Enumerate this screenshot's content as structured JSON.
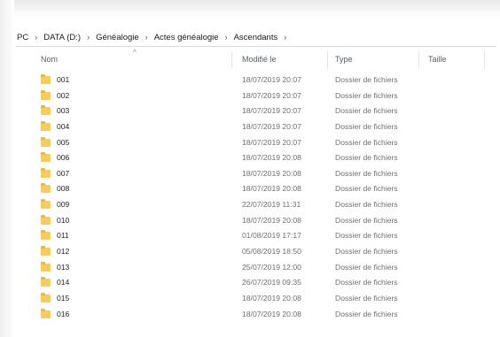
{
  "breadcrumb": [
    "PC",
    "DATA (D:)",
    "Généalogie",
    "Actes généalogie",
    "Ascendants"
  ],
  "breadcrumb_separator": "›",
  "columns": {
    "name": "Nom",
    "modified": "Modifié le",
    "type": "Type",
    "size": "Taille"
  },
  "sort_indicator": "^",
  "rows": [
    {
      "name": "001",
      "modified": "18/07/2019 20:07",
      "type": "Dossier de fichiers"
    },
    {
      "name": "002",
      "modified": "18/07/2019 20:07",
      "type": "Dossier de fichiers"
    },
    {
      "name": "003",
      "modified": "18/07/2019 20:07",
      "type": "Dossier de fichiers"
    },
    {
      "name": "004",
      "modified": "18/07/2019 20:07",
      "type": "Dossier de fichiers"
    },
    {
      "name": "005",
      "modified": "18/07/2019 20:07",
      "type": "Dossier de fichiers"
    },
    {
      "name": "006",
      "modified": "18/07/2019 20:08",
      "type": "Dossier de fichiers"
    },
    {
      "name": "007",
      "modified": "18/07/2019 20:08",
      "type": "Dossier de fichiers"
    },
    {
      "name": "008",
      "modified": "18/07/2019 20:08",
      "type": "Dossier de fichiers"
    },
    {
      "name": "009",
      "modified": "22/07/2019 11:31",
      "type": "Dossier de fichiers"
    },
    {
      "name": "010",
      "modified": "18/07/2019 20:08",
      "type": "Dossier de fichiers"
    },
    {
      "name": "011",
      "modified": "01/08/2019 17:17",
      "type": "Dossier de fichiers"
    },
    {
      "name": "012",
      "modified": "05/08/2019 18:50",
      "type": "Dossier de fichiers"
    },
    {
      "name": "013",
      "modified": "25/07/2019 12:00",
      "type": "Dossier de fichiers"
    },
    {
      "name": "014",
      "modified": "26/07/2019 09:35",
      "type": "Dossier de fichiers"
    },
    {
      "name": "015",
      "modified": "18/07/2019 20:08",
      "type": "Dossier de fichiers"
    },
    {
      "name": "016",
      "modified": "18/07/2019 20:08",
      "type": "Dossier de fichiers"
    }
  ],
  "icons": {
    "folder": "folder-icon"
  },
  "colors": {
    "folder": "#f3cc63",
    "header_text": "#4c607a",
    "date_text": "#707070"
  }
}
